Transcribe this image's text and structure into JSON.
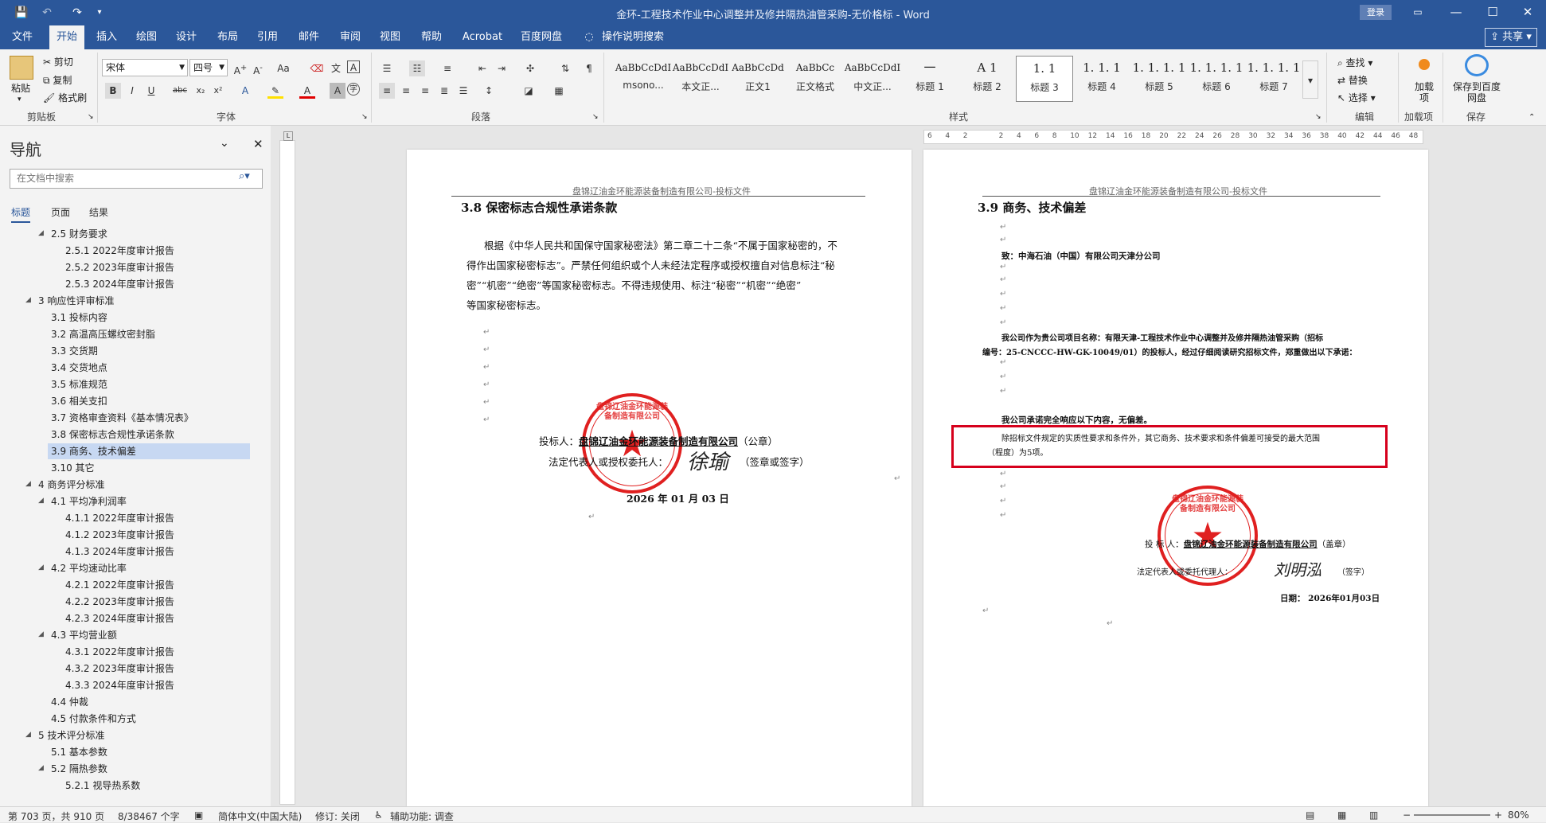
{
  "titlebar": {
    "title": "金环-工程技术作业中心调整并及修井隔热油管采购-无价格标 - Word",
    "login": "登录",
    "quick": [
      "💾",
      "↶",
      "↷",
      "▾"
    ]
  },
  "menu": {
    "tabs": [
      "文件",
      "开始",
      "插入",
      "绘图",
      "设计",
      "布局",
      "引用",
      "邮件",
      "审阅",
      "视图",
      "帮助",
      "Acrobat",
      "百度网盘"
    ],
    "tell": "操作说明搜索",
    "share": "共享"
  },
  "ribbon": {
    "clipboard": {
      "paste": "粘贴",
      "cut": "剪切",
      "copy": "复制",
      "painter": "格式刷",
      "label": "剪贴板"
    },
    "font": {
      "name": "宋体",
      "size": "四号",
      "label": "字体"
    },
    "paragraph": {
      "label": "段落"
    },
    "styles": {
      "label": "样式",
      "items": [
        {
          "preview": "AaBbCcDdI",
          "name": "msono..."
        },
        {
          "preview": "AaBbCcDdI",
          "name": "本文正..."
        },
        {
          "preview": "AaBbCcDd",
          "name": "正文1"
        },
        {
          "preview": "AaBbCc",
          "name": "正文格式"
        },
        {
          "preview": "AaBbCcDdI",
          "name": "中文正..."
        },
        {
          "preview": "一",
          "name": "标题 1"
        },
        {
          "preview": "A 1",
          "name": "标题 2"
        },
        {
          "preview": "1. 1",
          "name": "标题 3"
        },
        {
          "preview": "1. 1. 1",
          "name": "标题 4"
        },
        {
          "preview": "1. 1. 1. 1",
          "name": "标题 5"
        },
        {
          "preview": "1. 1. 1. 1",
          "name": "标题 6"
        },
        {
          "preview": "1. 1. 1. 1",
          "name": "标题 7"
        }
      ]
    },
    "editing": {
      "find": "查找",
      "replace": "替换",
      "select": "选择",
      "label": "编辑"
    },
    "addin": {
      "btn": "加载项",
      "label": "加载项"
    },
    "save": {
      "btn": "保存到百度网盘",
      "label": "保存"
    }
  },
  "nav": {
    "title": "导航",
    "search_placeholder": "在文档中搜索",
    "tabs": [
      "标题",
      "页面",
      "结果"
    ],
    "items": [
      {
        "text": "2.5 财务要求",
        "level": 2,
        "arrow": "◢"
      },
      {
        "text": "2.5.1 2022年度审计报告",
        "level": 3
      },
      {
        "text": "2.5.2 2023年度审计报告",
        "level": 3
      },
      {
        "text": "2.5.3 2024年度审计报告",
        "level": 3
      },
      {
        "text": "3 响应性评审标准",
        "level": 1,
        "arrow": "◢"
      },
      {
        "text": "3.1 投标内容",
        "level": 2
      },
      {
        "text": "3.2 高温高压螺纹密封脂",
        "level": 2
      },
      {
        "text": "3.3 交货期",
        "level": 2
      },
      {
        "text": "3.4 交货地点",
        "level": 2
      },
      {
        "text": "3.5 标准规范",
        "level": 2
      },
      {
        "text": "3.6 相关支扣",
        "level": 2
      },
      {
        "text": "3.7 资格审查资料《基本情况表》",
        "level": 2
      },
      {
        "text": "3.8 保密标志合规性承诺条款",
        "level": 2
      },
      {
        "text": "3.9 商务、技术偏差",
        "level": 2,
        "selected": true
      },
      {
        "text": "3.10 其它",
        "level": 2
      },
      {
        "text": "4 商务评分标准",
        "level": 1,
        "arrow": "◢"
      },
      {
        "text": "4.1 平均净利润率",
        "level": 2,
        "arrow": "◢"
      },
      {
        "text": "4.1.1 2022年度审计报告",
        "level": 3
      },
      {
        "text": "4.1.2 2023年度审计报告",
        "level": 3
      },
      {
        "text": "4.1.3 2024年度审计报告",
        "level": 3
      },
      {
        "text": "4.2 平均速动比率",
        "level": 2,
        "arrow": "◢"
      },
      {
        "text": "4.2.1 2022年度审计报告",
        "level": 3
      },
      {
        "text": "4.2.2 2023年度审计报告",
        "level": 3
      },
      {
        "text": "4.2.3 2024年度审计报告",
        "level": 3
      },
      {
        "text": "4.3 平均营业额",
        "level": 2,
        "arrow": "◢"
      },
      {
        "text": "4.3.1 2022年度审计报告",
        "level": 3
      },
      {
        "text": "4.3.2 2023年度审计报告",
        "level": 3
      },
      {
        "text": "4.3.3 2024年度审计报告",
        "level": 3
      },
      {
        "text": "4.4 仲裁",
        "level": 2
      },
      {
        "text": "4.5 付款条件和方式",
        "level": 2
      },
      {
        "text": "5 技术评分标准",
        "level": 1,
        "arrow": "◢"
      },
      {
        "text": "5.1 基本参数",
        "level": 2
      },
      {
        "text": "5.2 隔热参数",
        "level": 2,
        "arrow": "◢"
      },
      {
        "text": "5.2.1 视导热系数",
        "level": 3
      }
    ]
  },
  "ruler": {
    "ticks": [
      "6",
      "4",
      "2",
      "",
      "2",
      "4",
      "6",
      "8",
      "10",
      "12",
      "14",
      "16",
      "18",
      "20",
      "22",
      "24",
      "26",
      "28",
      "30",
      "32",
      "34",
      "36",
      "38",
      "40",
      "42",
      "44",
      "46",
      "48"
    ]
  },
  "page_left": {
    "header": "盘锦辽油金环能源装备制造有限公司-投标文件",
    "heading": "3.8 保密标志合规性承诺条款",
    "body": [
      "根据《中华人民共和国保守国家秘密法》第二章二十二条“不属于国家秘密的，不",
      "得作出国家秘密标志”。严禁任何组织或个人未经法定程序或授权擅自对信息标注“秘",
      "密”“机密”“绝密”等国家秘密标志。不得违规使用、标注“秘密”“机密”“绝密”",
      "等国家秘密标志。"
    ],
    "bidder_label": "投标人：",
    "bidder_name": "盘锦辽油金环能源装备制造有限公司",
    "bidder_suffix": "（公章）",
    "rep": "法定代表人或授权委托人：",
    "rep_suffix": "（签章或签字）",
    "signature": "徐瑜",
    "date": "2026 年 01 月 03 日",
    "seal_text": "盘锦辽油金环能源装备制造有限公司"
  },
  "page_right": {
    "header": "盘锦辽油金环能源装备制造有限公司-投标文件",
    "heading": "3.9 商务、技术偏差",
    "to": "致：中海石油（中国）有限公司天津分公司",
    "intro1": "我公司作为贵公司项目名称：有限天津-工程技术作业中心调整并及修井隔热油管采购（招标",
    "intro2": "编号：25-CNCCC-HW-GK-10049/01）的投标人，经过仔细阅读研究招标文件，郑重做出以下承诺：",
    "promise": "我公司承诺完全响应以下内容，无偏差。",
    "box1": "除招标文件规定的实质性要求和条件外，其它商务、技术要求和条件偏差可接受的最大范围",
    "box2": "（程度）为5项。",
    "bidder_label": "投 标 人：",
    "bidder_name": "盘锦辽油金环能源装备制造有限公司",
    "bidder_suffix": "（盖章）",
    "rep": "法定代表人或委托代理人：",
    "rep_suffix": "（签字）",
    "signature": "刘明泓",
    "date": "日期： 2026年01月03日",
    "seal_text": "盘锦辽油金环能源装备制造有限公司"
  },
  "colors": {
    "accent": "#2b579a",
    "highlight_box": "#d6001c",
    "seal": "#e02020"
  },
  "status": {
    "page": "第 703 页，共 910 页",
    "words": "8/38467 个字",
    "lang": "简体中文(中国大陆)",
    "track": "修订: 关闭",
    "access": "辅助功能: 调查",
    "zoom": "80%"
  }
}
